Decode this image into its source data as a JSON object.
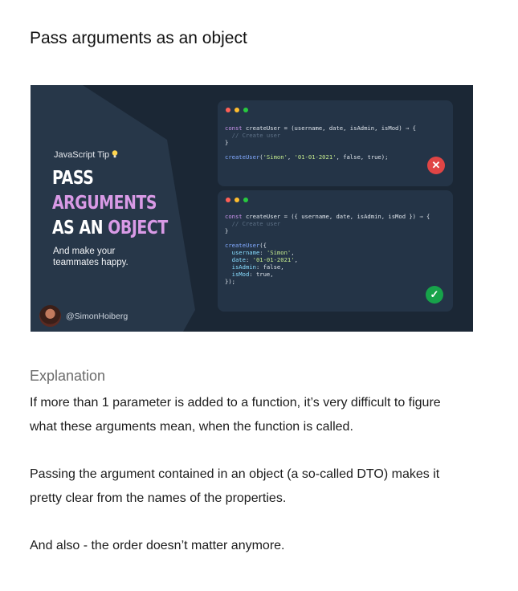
{
  "title": "Pass arguments as an object",
  "banner": {
    "tip_label": "JavaScript Tip",
    "headline": {
      "line1": "PASS",
      "line2": "ARGUMENTS",
      "line3_white": "AS AN ",
      "line3_accent": "OBJECT"
    },
    "subline1": "And make your",
    "subline2": "teammates happy.",
    "author_handle": "@SimonHoiberg",
    "colors": {
      "background": "#1b2735",
      "slab": "#273749",
      "accent": "#d99ae6",
      "card": "#243447",
      "error": "#e04545",
      "success": "#17a34a"
    },
    "window_dot_colors": [
      "#ff5f56",
      "#ffbd2e",
      "#27c93f"
    ],
    "bad_example": {
      "line1": {
        "kw": "const",
        "name": " createUser = (username, date, isAdmin, isMod) ⇒ {"
      },
      "line2": "  // Create user",
      "line3": "}",
      "call": {
        "fn": "createUser",
        "open": "(",
        "arg1": "'Simon'",
        "sep1": ", ",
        "arg2": "'01-01-2021'",
        "rest": ", false, true);"
      },
      "status_icon": "close-icon"
    },
    "good_example": {
      "line1": {
        "kw": "const",
        "name": " createUser = ({ username, date, isAdmin, isMod }) ⇒ {"
      },
      "line2": "  // Create user",
      "line3": "}",
      "call_open": {
        "fn": "createUser",
        "rest": "({"
      },
      "props": [
        {
          "key": "  username",
          "sep": ": ",
          "val": "'Simon'",
          "end": ","
        },
        {
          "key": "  date",
          "sep": ": ",
          "val": "'01-01-2021'",
          "end": ","
        },
        {
          "key": "  isAdmin",
          "sep": ": ",
          "val": "false",
          "end": ","
        },
        {
          "key": "  isMod",
          "sep": ": ",
          "val": "true",
          "end": ","
        }
      ],
      "call_close": "});",
      "status_icon": "check-icon"
    }
  },
  "explanation": {
    "heading": "Explanation",
    "p1_line1": "If more than 1 parameter is added to a function, it’s very difficult to figure",
    "p1_line2": "what these arguments mean, when the function is called.",
    "p2_line1": "Passing the argument contained in an object (a so-called DTO) makes it",
    "p2_line2": "pretty clear from the names of the properties.",
    "p3_line1": "And also - the order doesn’t matter anymore."
  }
}
